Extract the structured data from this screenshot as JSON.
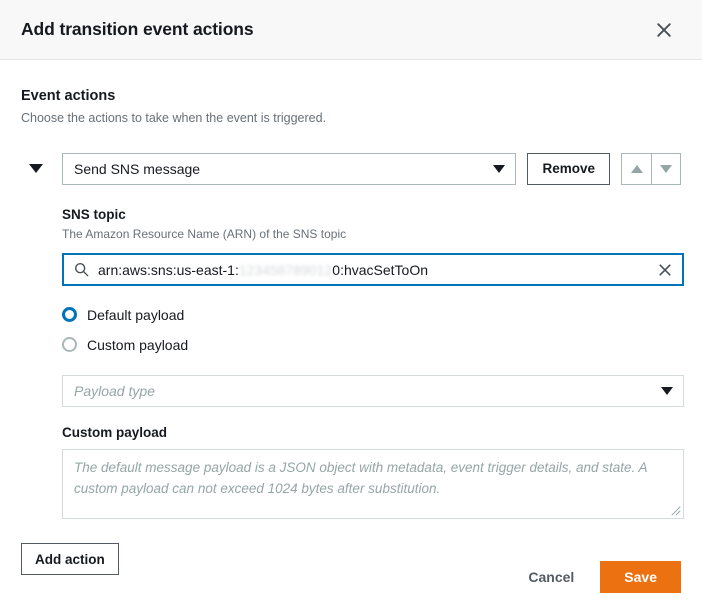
{
  "header": {
    "title": "Add transition event actions",
    "close_icon": "close-icon"
  },
  "event_actions": {
    "title": "Event actions",
    "description": "Choose the actions to take when the event is triggered.",
    "action_row": {
      "collapse_icon": "chevron-down-icon",
      "action_type": "Send SNS message",
      "dropdown_caret_icon": "caret-down-icon",
      "remove_label": "Remove",
      "move_up_icon": "caret-up-icon",
      "move_down_icon": "caret-down-icon"
    },
    "sns_topic": {
      "label": "SNS topic",
      "hint": "The Amazon Resource Name (ARN) of the SNS topic",
      "search_icon": "search-icon",
      "clear_icon": "clear-x-icon",
      "value_prefix": "arn:aws:sns:us-east-1:",
      "value_redacted": "123456789012",
      "value_suffix": "0:hvacSetToOn",
      "focus_color": "#0073bb"
    },
    "payload_choice": {
      "options": [
        {
          "label": "Default payload",
          "selected": true
        },
        {
          "label": "Custom payload",
          "selected": false
        }
      ]
    },
    "payload_type": {
      "placeholder": "Payload type",
      "caret_icon": "caret-down-icon"
    },
    "custom_payload": {
      "label": "Custom payload",
      "placeholder": "The default message payload is a JSON object with metadata, event trigger details, and state. A custom payload can not exceed 1024 bytes after substitution.",
      "resize_icon": "resize-grip-icon"
    },
    "add_action_label": "Add action"
  },
  "footer": {
    "cancel_label": "Cancel",
    "save_label": "Save",
    "save_color": "#ec7211"
  }
}
